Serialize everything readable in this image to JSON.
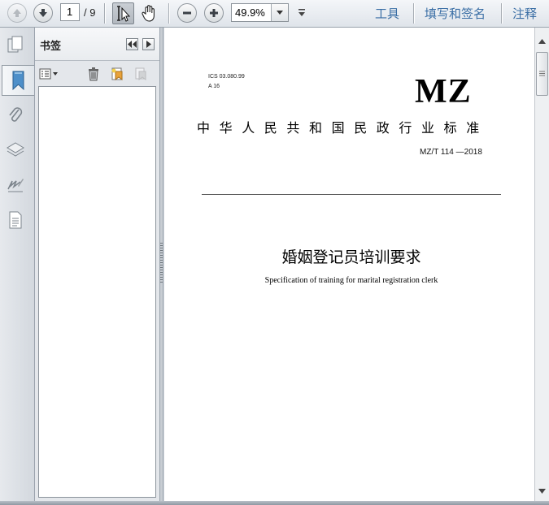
{
  "toolbar": {
    "prev_page_icon": "arrow-up-icon",
    "next_page_icon": "arrow-down-icon",
    "current_page": "1",
    "total_pages": "/ 9",
    "zoom_value": "49.9%",
    "links": {
      "tools": "工具",
      "fill_sign": "填写和签名",
      "comment": "注释"
    }
  },
  "rail": {
    "icons": [
      "pages-icon",
      "bookmark-icon",
      "attachment-icon",
      "layers-icon",
      "signature-icon",
      "content-icon"
    ]
  },
  "bookmarks_panel": {
    "title": "书签"
  },
  "document": {
    "ics": "ICS 03.080.99",
    "category": "A 16",
    "logo": "MZ",
    "org": "中华人民共和国民政行业标准",
    "standard_number": "MZ/T 114 —2018",
    "title_cn": "婚姻登记员培训要求",
    "title_en": "Specification of training for marital registration clerk"
  },
  "colors": {
    "link": "#3a6ea5",
    "toolbar_bg": "#e8ebef",
    "page_bg": "#ffffff"
  }
}
